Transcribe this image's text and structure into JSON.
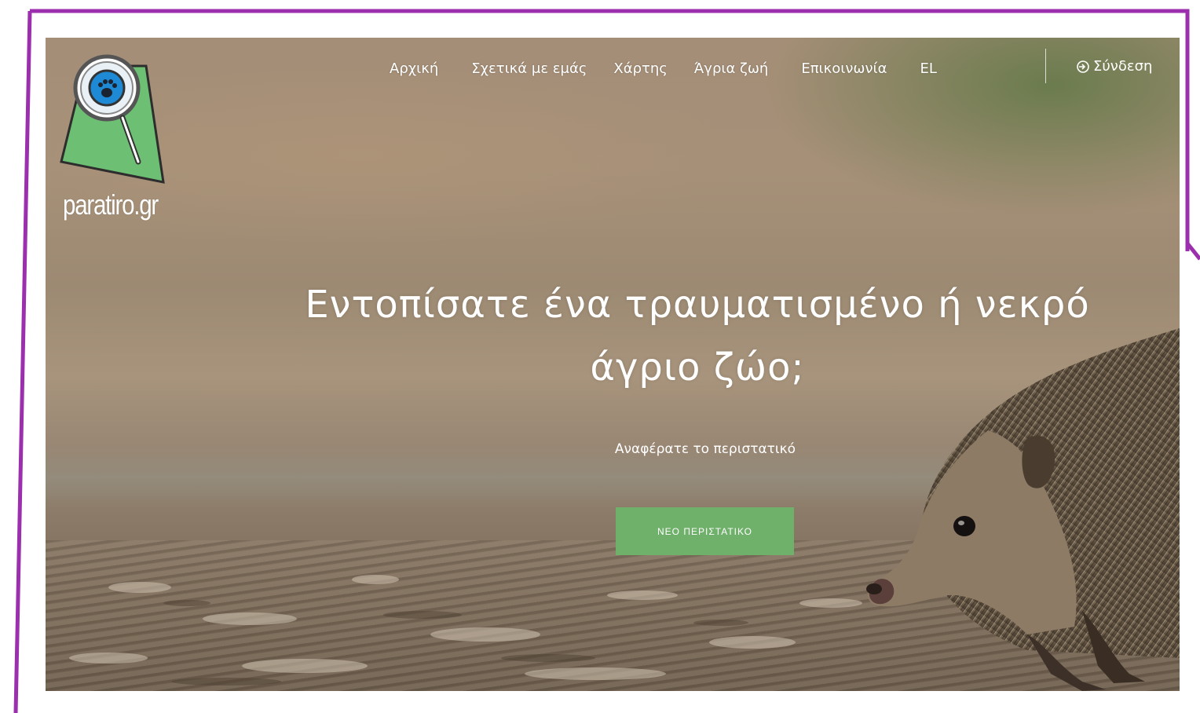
{
  "colors": {
    "frame_border": "#9b2fae",
    "cta_background": "#6fb06a",
    "logo_green": "#6cbf73",
    "logo_lens_blue": "#1e8ad6"
  },
  "logo": {
    "text": "paratiro.gr",
    "icon": "magnifier-paw-map-icon"
  },
  "nav": {
    "items": [
      {
        "label": "Αρχική"
      },
      {
        "label": "Σχετικά με εμάς"
      },
      {
        "label": "Χάρτης"
      },
      {
        "label": "Άγρια ζωή"
      },
      {
        "label": "Επικοινωνία"
      },
      {
        "label": "EL"
      }
    ],
    "login_label": "Σύνδεση",
    "login_icon": "sign-in-icon"
  },
  "hero": {
    "title_line1": "Εντοπίσατε ένα τραυματισμένο ή νεκρό",
    "title_line2": "άγριο ζώο;",
    "subtitle": "Αναφέρατε το περιστατικό",
    "cta_label": "ΝΕΟ ΠΕΡΙΣΤΑΤΙΚΟ"
  }
}
